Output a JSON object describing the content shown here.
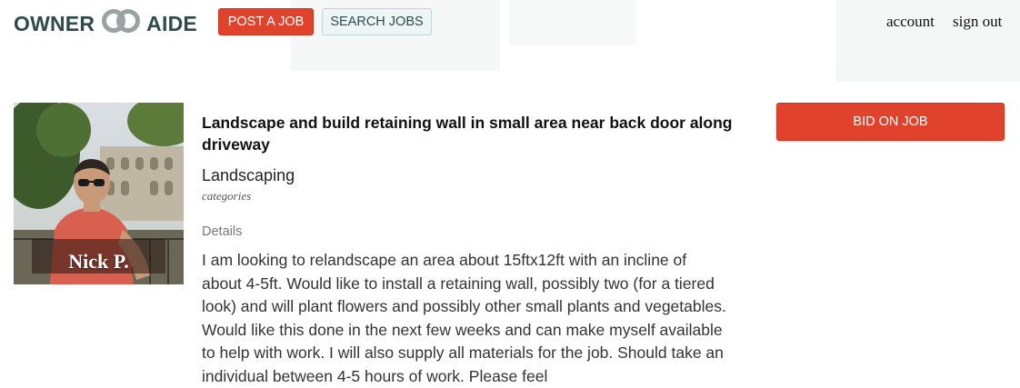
{
  "header": {
    "logo_left": "OWNER",
    "logo_right": "AIDE",
    "logo_icon": "linked-rings-logo-icon",
    "post_job_label": "POST A JOB",
    "search_jobs_label": "SEARCH JOBS",
    "account_label": "account",
    "sign_out_label": "sign out"
  },
  "owner": {
    "name": "Nick P.",
    "photo_icon": "person-photo"
  },
  "job": {
    "title": "Landscape and build retaining wall in small area near back door along driveway",
    "category": "Landscaping",
    "category_caption": "categories",
    "details_heading": "Details",
    "description": "I am looking to relandscape an area about 15ftx12ft with an incline of about 4-5ft. Would like to install a retaining wall, possibly two (for a tiered look) and will plant flowers and possibly other small plants and vegetables. Would like this done in the next few weeks and can make myself available to help with work. I will also supply all materials for the job. Should take an individual between 4-5 hours of work. Please feel"
  },
  "actions": {
    "bid_label": "BID ON JOB"
  },
  "colors": {
    "accent": "#e1422c",
    "brand": "#2e4a4d"
  }
}
